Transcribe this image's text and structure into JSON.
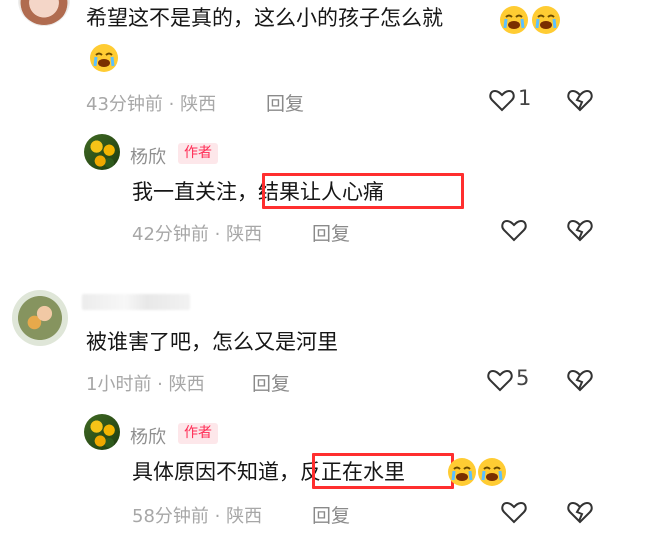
{
  "comment1": {
    "text_line1": "希望这不是真的，这么小的孩子怎么就",
    "emoji": "crying-face",
    "meta": "43分钟前 · 陕西",
    "reply_label": "回复",
    "like_count": "1"
  },
  "reply1": {
    "author": "杨欣",
    "badge": "作者",
    "text_plain": "我一直关注，",
    "text_highlight": "结果让人心痛",
    "meta": "42分钟前 · 陕西",
    "reply_label": "回复"
  },
  "comment2": {
    "text": "被谁害了吧，怎么又是河里",
    "meta": "1小时前 · 陕西",
    "reply_label": "回复",
    "like_count": "5"
  },
  "reply2": {
    "author": "杨欣",
    "badge": "作者",
    "text_plain": "具体原因不知道，",
    "text_highlight": "反正在水里",
    "meta": "58分钟前 · 陕西",
    "reply_label": "回复"
  },
  "colors": {
    "highlight_border": "#ff2f2f",
    "badge_text": "#ff2c55",
    "badge_bg": "#fde7ea",
    "meta_text": "#a7a7a7"
  },
  "icons": [
    "heart-icon",
    "broken-heart-icon",
    "crying-face-emoji"
  ]
}
